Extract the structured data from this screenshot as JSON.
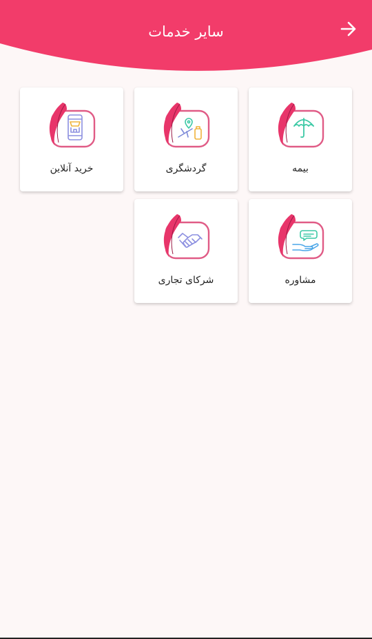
{
  "header": {
    "title": "سایر خدمات",
    "back_icon": "arrow-right-icon",
    "color": "#f23c6a"
  },
  "services": [
    {
      "id": "insurance",
      "label": "بیمه",
      "icon": "umbrella-icon",
      "icon_color": "#3cc9a5"
    },
    {
      "id": "tourism",
      "label": "گردشگری",
      "icon": "travel-icon",
      "icon_color": "#7d8ad8"
    },
    {
      "id": "online-shopping",
      "label": "خرید آنلاین",
      "icon": "shop-icon",
      "icon_color": "#8c8fe0"
    },
    {
      "id": "consulting",
      "label": "مشاوره",
      "icon": "consulting-icon",
      "icon_color": "#4aa6e8"
    },
    {
      "id": "business-partners",
      "label": "شرکای تجاری",
      "icon": "handshake-icon",
      "icon_color": "#8c8fe0"
    }
  ],
  "brand": {
    "accent": "#e8356a",
    "frame": "#e05b86"
  }
}
